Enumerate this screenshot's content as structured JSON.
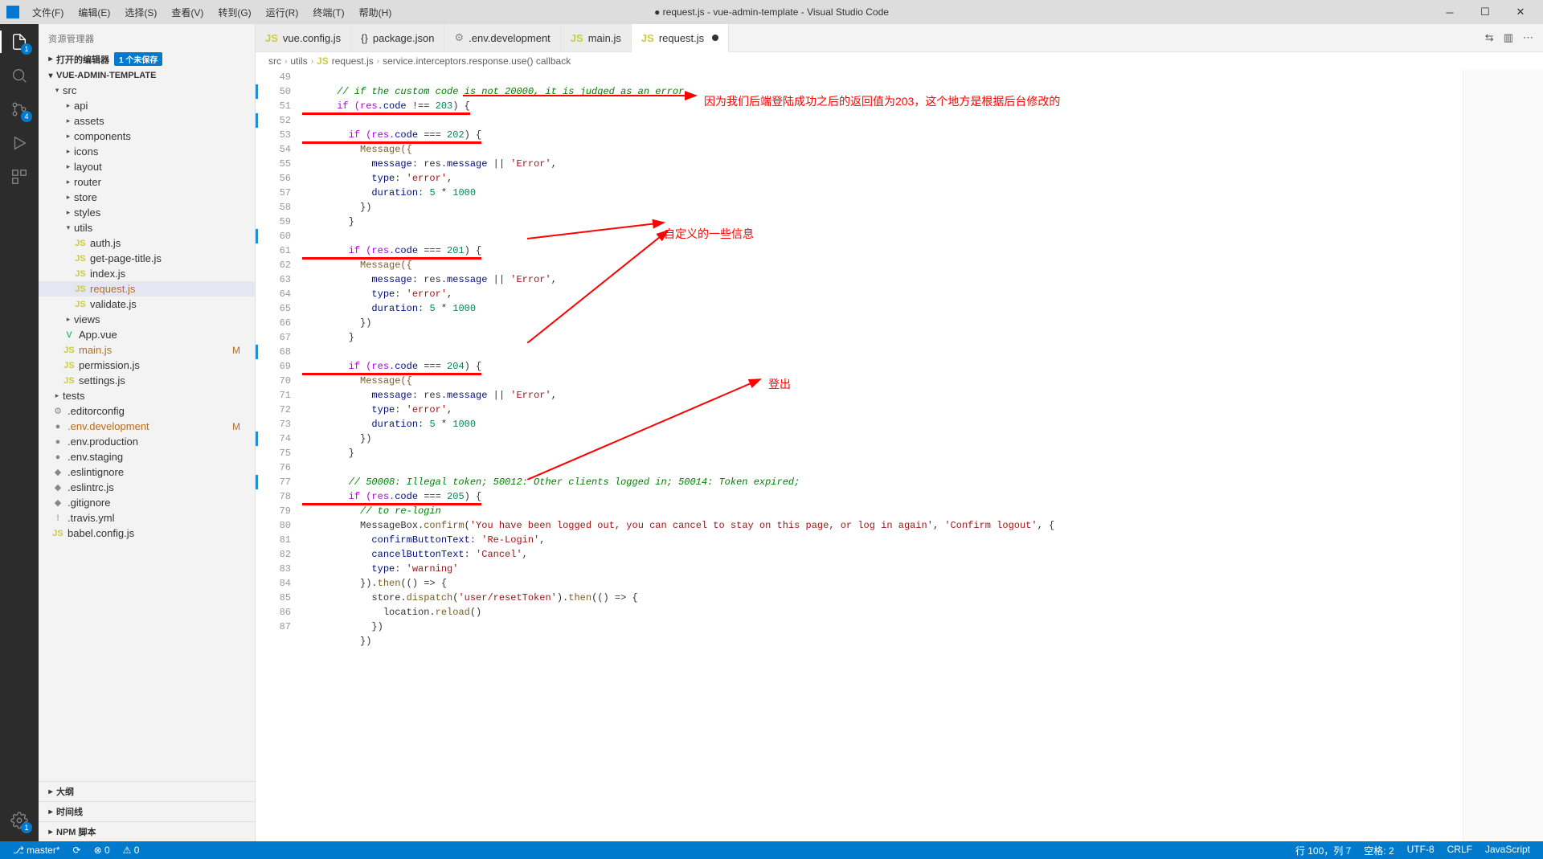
{
  "window": {
    "title": "● request.js - vue-admin-template - Visual Studio Code"
  },
  "menu": [
    "文件(F)",
    "编辑(E)",
    "选择(S)",
    "查看(V)",
    "转到(G)",
    "运行(R)",
    "终端(T)",
    "帮助(H)"
  ],
  "activity": {
    "explorer_badge": "1",
    "scm_badge": "4",
    "settings_badge": "1"
  },
  "sidebar": {
    "title": "资源管理器",
    "open_editors": {
      "label": "打开的编辑器",
      "badge": "1 个未保存"
    },
    "project": "VUE-ADMIN-TEMPLATE",
    "tree": {
      "src": "src",
      "api": "api",
      "assets": "assets",
      "components": "components",
      "icons": "icons",
      "layout": "layout",
      "router": "router",
      "store": "store",
      "styles": "styles",
      "utils": "utils",
      "authjs": "auth.js",
      "getpagetitle": "get-page-title.js",
      "indexjs": "index.js",
      "requestjs": "request.js",
      "validatejs": "validate.js",
      "views": "views",
      "appvue": "App.vue",
      "mainjs": "main.js",
      "permissionjs": "permission.js",
      "settingsjs": "settings.js",
      "tests": "tests",
      "editorconfig": ".editorconfig",
      "envdev": ".env.development",
      "envprod": ".env.production",
      "envstage": ".env.staging",
      "eslintignore": ".eslintignore",
      "eslintrc": ".eslintrc.js",
      "gitignore": ".gitignore",
      "travis": ".travis.yml",
      "babel": "babel.config.js"
    },
    "modified": "M",
    "outline": "大纲",
    "timeline": "时间线",
    "npm": "NPM 脚本"
  },
  "tabs": [
    {
      "icon": "JS",
      "label": "vue.config.js"
    },
    {
      "icon": "{}",
      "label": "package.json"
    },
    {
      "icon": "⚙",
      "label": ".env.development"
    },
    {
      "icon": "JS",
      "label": "main.js"
    },
    {
      "icon": "JS",
      "label": "request.js",
      "active": true,
      "dirty": true
    }
  ],
  "breadcrumb": {
    "p1": "src",
    "p2": "utils",
    "p3": "request.js",
    "p4": "service.interceptors.response.use() callback"
  },
  "line_numbers": [
    "49",
    "50",
    "51",
    "52",
    "53",
    "54",
    "55",
    "56",
    "57",
    "58",
    "59",
    "60",
    "61",
    "62",
    "63",
    "64",
    "65",
    "66",
    "67",
    "68",
    "69",
    "70",
    "71",
    "72",
    "73",
    "74",
    "75",
    "76",
    "77",
    "78",
    "79",
    "80",
    "81",
    "82",
    "83",
    "84",
    "85",
    "86",
    "87"
  ],
  "code_lines": {
    "49": "      // if the custom code is not 20000, it is judged as an error.",
    "50_a": "      if (res.",
    "50_b": "code",
    "50_c": " !== ",
    "50_d": "203",
    "50_e": ") {",
    "52_a": "        if (res.",
    "52_b": "code",
    "52_c": " === ",
    "52_d": "202",
    "52_e": ") {",
    "53": "          Message({",
    "54_a": "            message",
    "54_b": ": res.",
    "54_c": "message",
    "54_d": " || ",
    "54_e": "'Error'",
    "54_f": ",",
    "55_a": "            type",
    "55_b": ": ",
    "55_c": "'error'",
    "55_d": ",",
    "56_a": "            duration",
    "56_b": ": ",
    "56_c": "5",
    "56_d": " * ",
    "56_e": "1000",
    "57": "          })",
    "58": "        }",
    "60_a": "        if (res.",
    "60_b": "code",
    "60_c": " === ",
    "60_d": "201",
    "60_e": ") {",
    "61": "          Message({",
    "62_a": "            message",
    "62_b": ": res.",
    "62_c": "message",
    "62_d": " || ",
    "62_e": "'Error'",
    "62_f": ",",
    "63_a": "            type",
    "63_b": ": ",
    "63_c": "'error'",
    "63_d": ",",
    "64_a": "            duration",
    "64_b": ": ",
    "64_c": "5",
    "64_d": " * ",
    "64_e": "1000",
    "65": "          })",
    "66": "        }",
    "68_a": "        if (res.",
    "68_b": "code",
    "68_c": " === ",
    "68_d": "204",
    "68_e": ") {",
    "69": "          Message({",
    "70_a": "            message",
    "70_b": ": res.",
    "70_c": "message",
    "70_d": " || ",
    "70_e": "'Error'",
    "70_f": ",",
    "71_a": "            type",
    "71_b": ": ",
    "71_c": "'error'",
    "71_d": ",",
    "72_a": "            duration",
    "72_b": ": ",
    "72_c": "5",
    "72_d": " * ",
    "72_e": "1000",
    "73": "          })",
    "74": "        }",
    "76": "        // 50008: Illegal token; 50012: Other clients logged in; 50014: Token expired;",
    "77_a": "        if (res.",
    "77_b": "code",
    "77_c": " === ",
    "77_d": "205",
    "77_e": ") {",
    "78": "          // to re-login",
    "79_a": "          MessageBox.",
    "79_b": "confirm",
    "79_c": "(",
    "79_d": "'You have been logged out, you can cancel to stay on this page, or log in again'",
    "79_e": ", ",
    "79_f": "'Confirm logout'",
    "79_g": ", {",
    "80_a": "            confirmButtonText",
    "80_b": ": ",
    "80_c": "'Re-Login'",
    "80_d": ",",
    "81_a": "            cancelButtonText",
    "81_b": ": ",
    "81_c": "'Cancel'",
    "81_d": ",",
    "82_a": "            type",
    "82_b": ": ",
    "82_c": "'warning'",
    "83_a": "          }).",
    "83_b": "then",
    "83_c": "(() => {",
    "84_a": "            store.",
    "84_b": "dispatch",
    "84_c": "(",
    "84_d": "'user/resetToken'",
    "84_e": ").",
    "84_f": "then",
    "84_g": "(() => {",
    "85_a": "              location.",
    "85_b": "reload",
    "85_c": "()",
    "86": "            })",
    "87": "          })"
  },
  "annotations": {
    "a1": "因为我们后端登陆成功之后的返回值为203，这个地方是根据后台修改的",
    "a2": "自定义的一些信息",
    "a3": "登出"
  },
  "statusbar": {
    "branch": "master*",
    "sync": "⟳",
    "errors": "⊗ 0",
    "warnings": "⚠ 0",
    "line_col": "行 100，列 7",
    "spaces": "空格: 2",
    "encoding": "UTF-8",
    "eol": "CRLF",
    "lang": "JavaScript"
  }
}
